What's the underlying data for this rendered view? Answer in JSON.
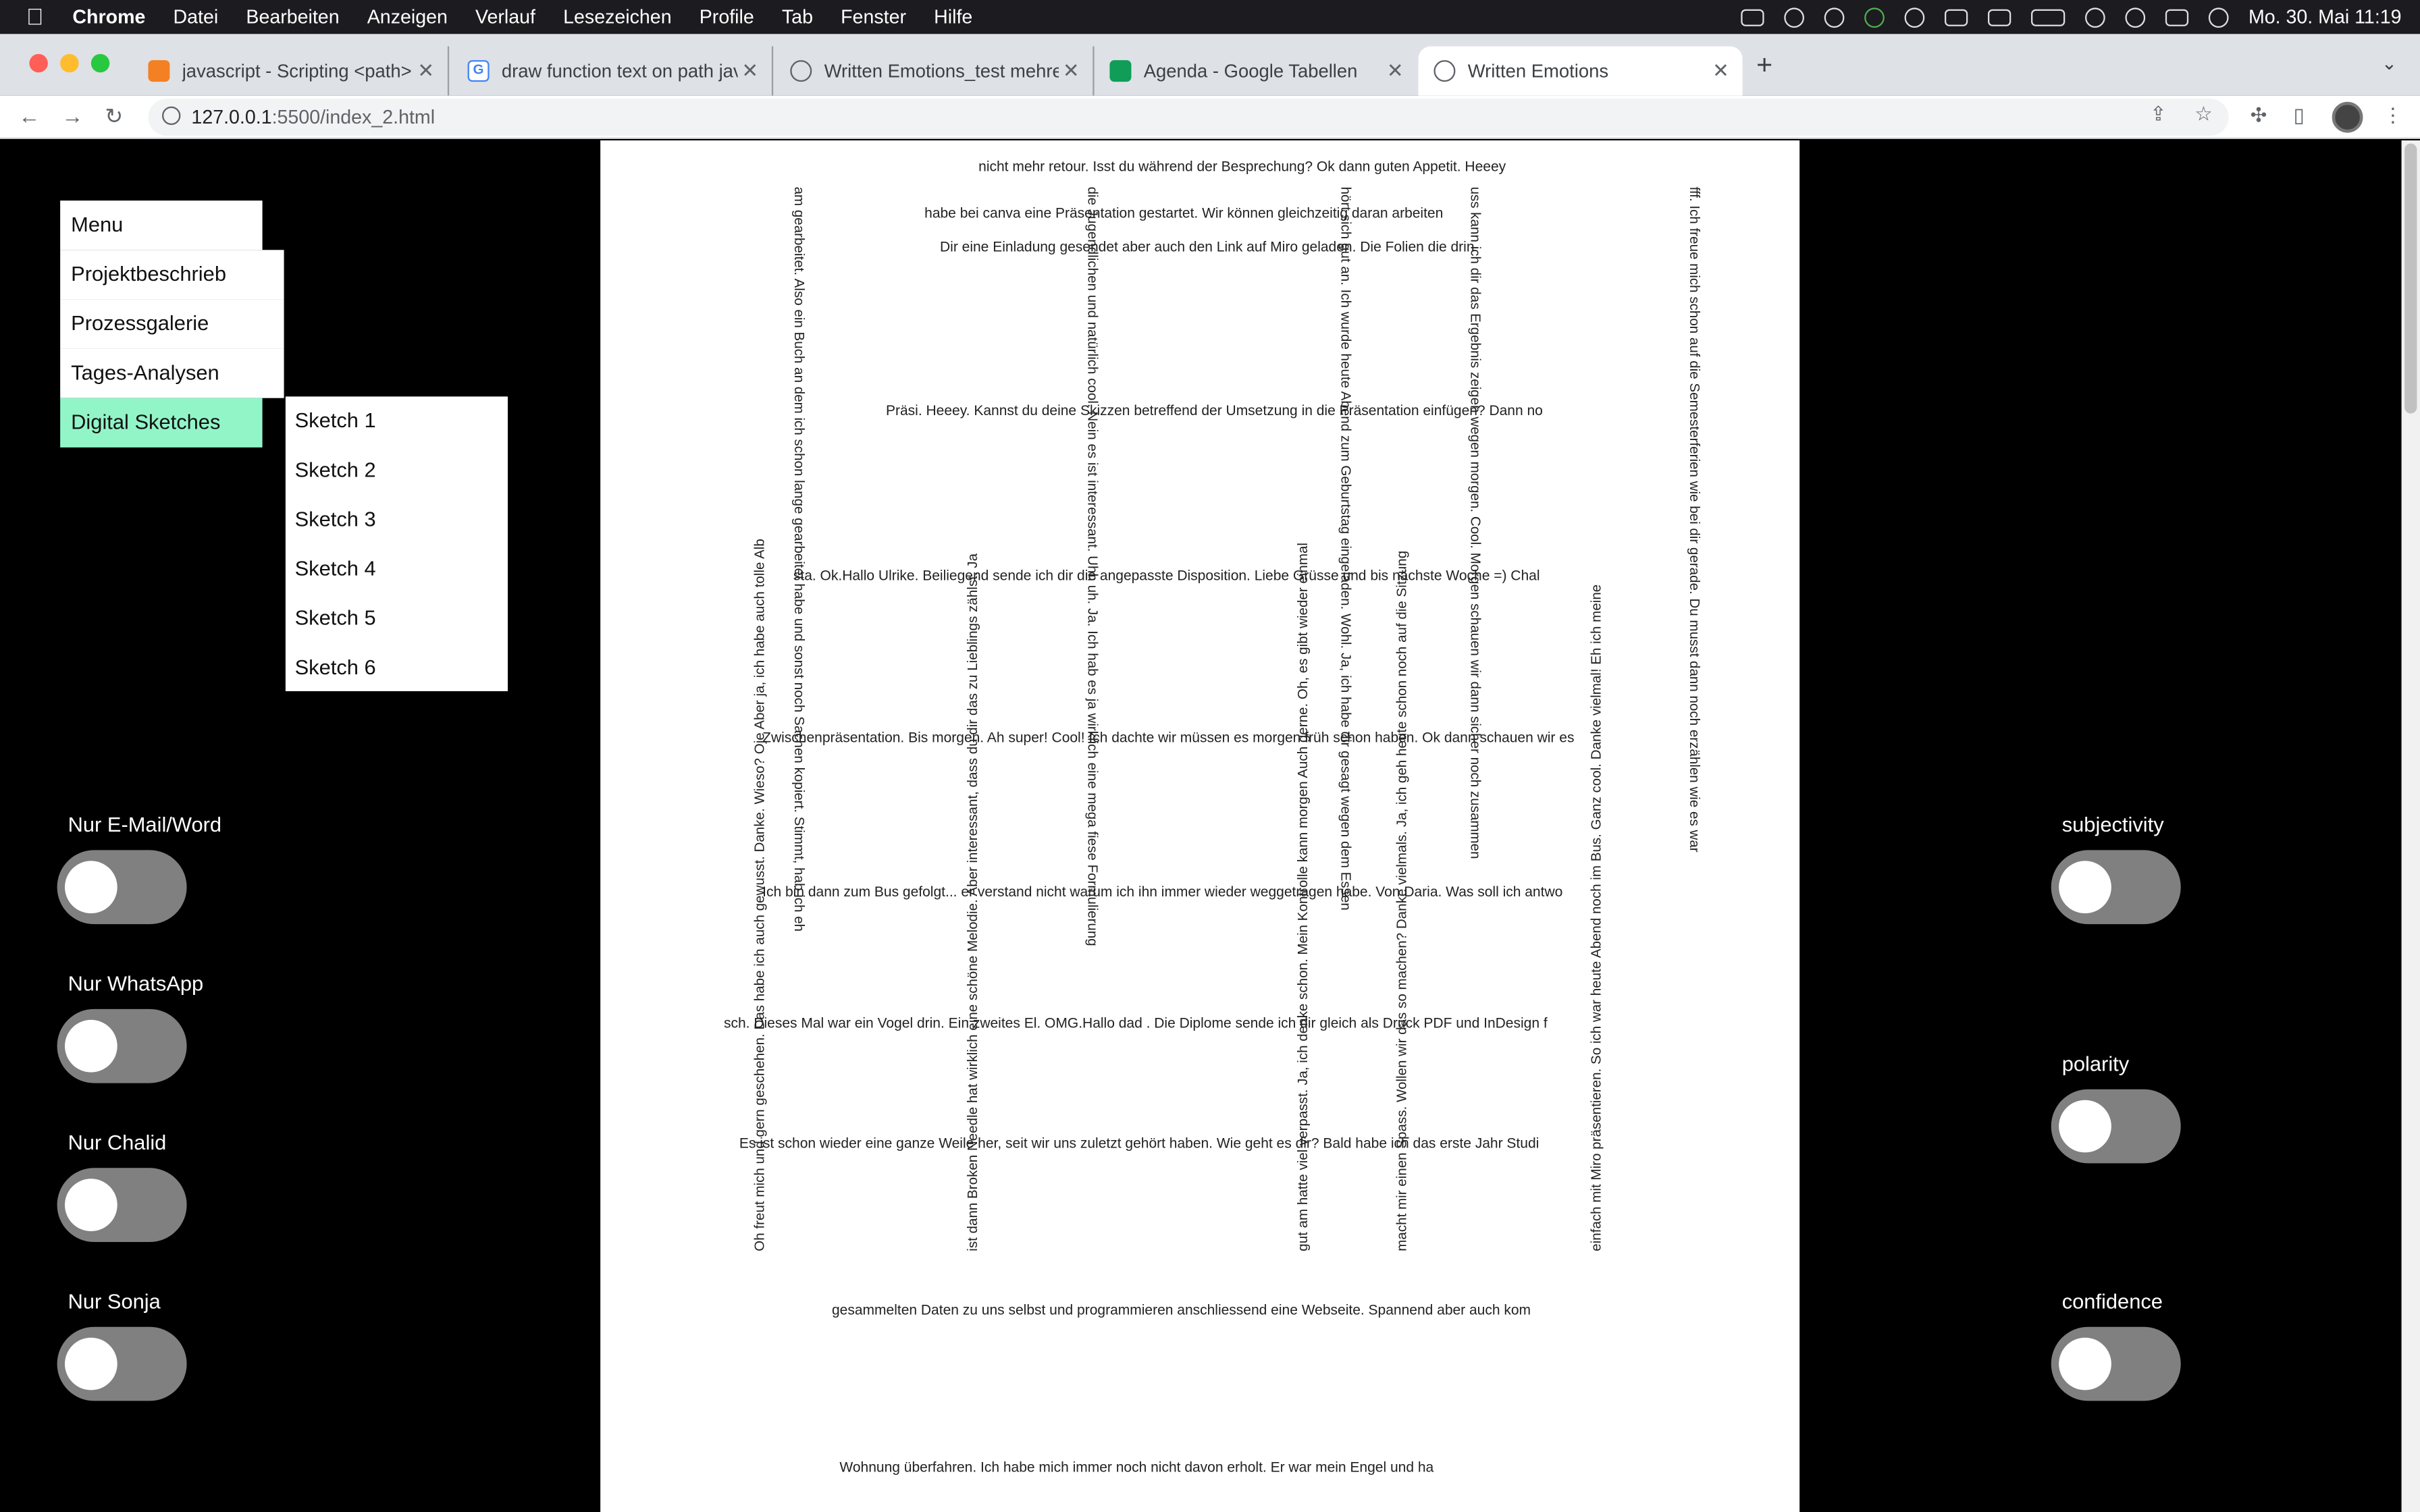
{
  "macbar": {
    "app": "Chrome",
    "menus": [
      "Datei",
      "Bearbeiten",
      "Anzeigen",
      "Verlauf",
      "Lesezeichen",
      "Profile",
      "Tab",
      "Fenster",
      "Hilfe"
    ],
    "clock": "Mo. 30. Mai  11:19"
  },
  "tabs": [
    {
      "title": "javascript - Scripting <path> d",
      "icon": "stackoverflow-icon",
      "color": "#f48024"
    },
    {
      "title": "draw function text on path java",
      "icon": "google-icon",
      "color": "#4285f4"
    },
    {
      "title": "Written Emotions_test mehrere",
      "icon": "globe-icon",
      "color": "#5f6368"
    },
    {
      "title": "Agenda - Google Tabellen",
      "icon": "sheets-icon",
      "color": "#0f9d58"
    },
    {
      "title": "Written Emotions",
      "icon": "globe-icon",
      "color": "#5f6368"
    }
  ],
  "address": {
    "host": "127.0.0.1",
    "rest": ":5500/index_2.html"
  },
  "menu": {
    "items": [
      "Menu",
      "Projektbeschrieb",
      "Prozessgalerie",
      "Tages-Analysen",
      "Digital Sketches"
    ],
    "sub": [
      "Sketch 1",
      "Sketch 2",
      "Sketch 3",
      "Sketch 4",
      "Sketch 5",
      "Sketch 6"
    ],
    "accent": "#92f5c8"
  },
  "left_toggles": [
    "Nur E-Mail/Word",
    "Nur WhatsApp",
    "Nur Chalid",
    "Nur Sonja"
  ],
  "right_toggles": [
    "subjectivity",
    "polarity",
    "confidence"
  ],
  "text_lines": [
    "Präsi. Heeey. Kannst du deine Skizzen betreffend der Umsetzung in die Präsentation einfügen? Dann no",
    "sta. Ok.Hallo Ulrike. Beiliegend sende ich dir die angepasste Disposition. Liebe Grüsse und bis nächste Woche =) Chal",
    "Zwischenpräsentation. Bis morgen. Ah super! Cool! Ich dachte wir müssen es morgen früh schon haben. Ok dann schauen wir es",
    "Ich bin dann zum Bus gefolgt... er verstand nicht warum ich ihn immer wieder weggetragen habe. Von Daria. Was soll ich antwo",
    "sch. Dieses Mal war ein Vogel drin. Ein zweites El. OMG.Hallo dad . Die Diplome sende ich dir gleich als Druck PDF und InDesign f",
    "Es ist schon wieder eine ganze Weile her, seit wir uns zuletzt gehört haben. Wie geht es dir? Bald habe ich das erste Jahr Studi",
    "gesammelten Daten zu uns selbst und programmieren anschliessend eine Webseite. Spannend aber auch kom",
    "Wohnung überfahren. Ich habe mich immer noch nicht davon erholt. Er war mein Engel und ha",
    "nicht mehr retour. Isst du während der Besprechung? Ok dann guten Appetit. Heeey",
    "habe bei canva eine Präsentation gestartet. Wir können gleichzeitig daran arbeiten",
    "Dir eine Einladung gesendet aber auch den Link auf Miro geladen. Die Folien die drin"
  ],
  "vertical_lines": [
    "Oh freut mich und gern geschehen. Das habe ich auch gewusst. Danke. Wieso? Oje Aber ja, ich habe auch tolle Alb",
    "am gearbeitet. Also ein Buch an dem ich schon lange gearbeitet habe und sonst noch Sachen kopiert. Stimmt, hab ich eh",
    "ist dann Broken Needle hat wirklich eine schöne Melodie. Aber interessant, dass du dir das zu Lieblings zählst. Ja",
    "die Jugendlichen und natürlich cool. Nein es ist interessant. Uhh uh. Ja. Ich hab es ja wirklich eine mega fiese Formulierung",
    "gut am hatte viel verpasst. Ja, ich denke schon. Mein Kontrolle kann morgen Auch gerne. Oh, es gibt wieder einmal",
    "hört sich gut an. Ich wurde heute Abend zum Geburtstag eingeladen. Wohl. Ja, ich habe dir gesagt wegen dem Essen",
    "macht mir einen Spass. Wollen wir das so machen? Danke vielmals. Ja, ich geh heute schon noch auf die Sitzung",
    "uss kann ich dir das Ergebnis zeigen wegen morgen. Cool. Morgen schauen wir dann sicher noch zusammen",
    "einfach mit Miro präsentieren. So ich war heute Abend noch im Bus. Ganz cool. Danke vielmal! Eh ich meine",
    "fff. Ich freue mich schon auf die Semesterferien wie bei dir gerade. Du musst dann noch erzählen wie es war"
  ]
}
